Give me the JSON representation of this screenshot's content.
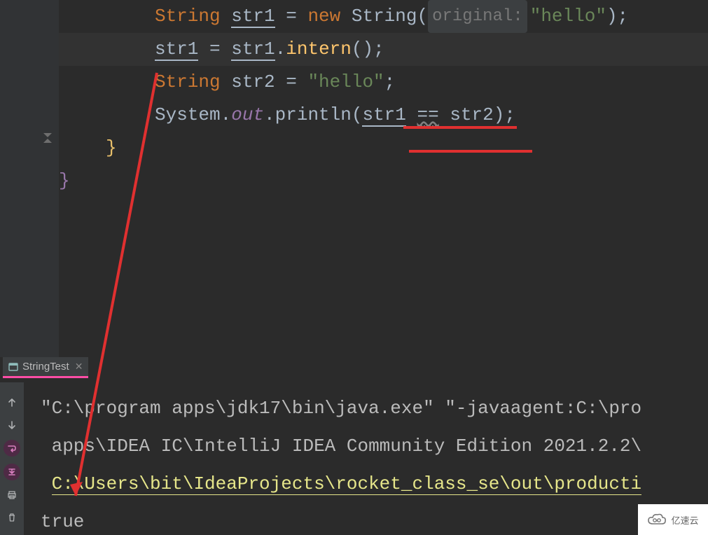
{
  "editor": {
    "lines": [
      {
        "type": "code",
        "highlight": false,
        "indent": "indent1",
        "tokens": [
          {
            "t": "String ",
            "cls": "kw"
          },
          {
            "t": "str1",
            "cls": "ident underline"
          },
          {
            "t": " = ",
            "cls": "pun"
          },
          {
            "t": "new ",
            "cls": "kw"
          },
          {
            "t": "String(",
            "cls": "ident"
          },
          {
            "t": "original:",
            "cls": "",
            "hint": true
          },
          {
            "t": "\"hello\"",
            "cls": "str"
          },
          {
            "t": ");",
            "cls": "pun"
          }
        ]
      },
      {
        "type": "code",
        "highlight": true,
        "indent": "indent1",
        "tokens": [
          {
            "t": "str1",
            "cls": "ident underline"
          },
          {
            "t": " = ",
            "cls": "pun"
          },
          {
            "t": "str1",
            "cls": "ident underline"
          },
          {
            "t": ".",
            "cls": "pun"
          },
          {
            "t": "intern",
            "cls": "fn"
          },
          {
            "t": "();",
            "cls": "pun"
          }
        ]
      },
      {
        "type": "code",
        "highlight": false,
        "indent": "indent1",
        "tokens": [
          {
            "t": "String ",
            "cls": "kw"
          },
          {
            "t": "str2 = ",
            "cls": "ident"
          },
          {
            "t": "\"hello\"",
            "cls": "str"
          },
          {
            "t": ";",
            "cls": "pun"
          }
        ]
      },
      {
        "type": "code",
        "highlight": false,
        "indent": "indent1",
        "tokens": [
          {
            "t": "System.",
            "cls": "ident"
          },
          {
            "t": "out",
            "cls": "field"
          },
          {
            "t": ".println(",
            "cls": "ident"
          },
          {
            "t": "str1",
            "cls": "ident underline"
          },
          {
            "t": " ",
            "cls": "pun"
          },
          {
            "t": "==",
            "cls": "op-eq wavy"
          },
          {
            "t": " str2",
            "cls": "ident"
          },
          {
            "t": ");",
            "cls": "pun"
          }
        ]
      },
      {
        "type": "code",
        "highlight": false,
        "indent": "indent0b",
        "tokens": [
          {
            "t": "}",
            "cls": "brace1"
          }
        ]
      },
      {
        "type": "code",
        "highlight": false,
        "indent": "indent0a",
        "tokens": [
          {
            "t": "}",
            "cls": "brace2"
          }
        ]
      }
    ]
  },
  "tab": {
    "label": "StringTest"
  },
  "console": {
    "lines": [
      {
        "segments": [
          {
            "t": "\"C:\\program apps\\jdk17\\bin\\java.exe\" \"-javaagent:C:\\pro",
            "cls": ""
          }
        ]
      },
      {
        "segments": [
          {
            "t": " apps\\IDEA IC\\IntelliJ IDEA Community Edition 2021.2.2\\",
            "cls": ""
          }
        ]
      },
      {
        "segments": [
          {
            "t": " ",
            "cls": ""
          },
          {
            "t": "C:\\Users\\bit\\IdeaProjects\\rocket_class_se\\out\\producti",
            "cls": "link"
          }
        ]
      },
      {
        "segments": [
          {
            "t": "true",
            "cls": ""
          }
        ]
      }
    ]
  },
  "run_toolbar": {
    "buttons": [
      "up",
      "down",
      "wrap",
      "scroll-to-end",
      "print",
      "trash"
    ]
  },
  "watermark": {
    "text": "亿速云",
    "side": "cs"
  }
}
